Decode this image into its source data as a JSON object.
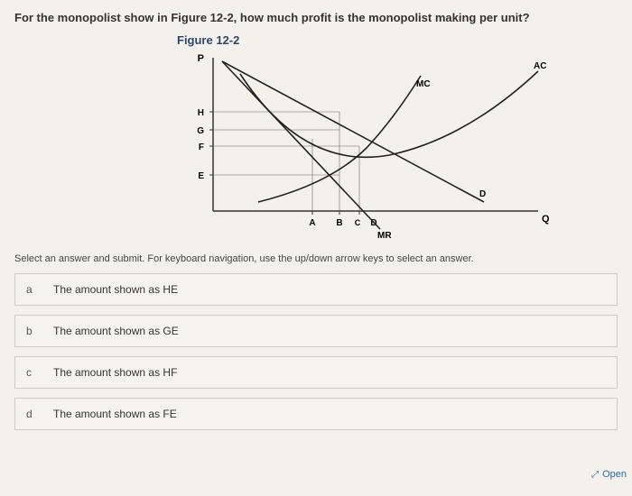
{
  "question": "For the monopolist show in Figure 12-2, how much profit is the monopolist making per unit?",
  "figure": {
    "title": "Figure 12-2",
    "y_axis": "P",
    "x_axis": "Q",
    "y_ticks": [
      "H",
      "G",
      "F",
      "E"
    ],
    "x_ticks": [
      "A",
      "B",
      "C",
      "D"
    ],
    "curve_mc": "MC",
    "curve_ac": "AC",
    "curve_mr": "MR",
    "x_d_label": "D",
    "d_on_curve": "D"
  },
  "instructions": "Select an answer and submit. For keyboard navigation, use the up/down arrow keys to select an answer.",
  "options": [
    {
      "letter": "a",
      "text": "The amount shown as HE"
    },
    {
      "letter": "b",
      "text": "The amount shown as GE"
    },
    {
      "letter": "c",
      "text": "The amount shown as HF"
    },
    {
      "letter": "d",
      "text": "The amount shown as FE"
    }
  ],
  "open_label": "Open"
}
